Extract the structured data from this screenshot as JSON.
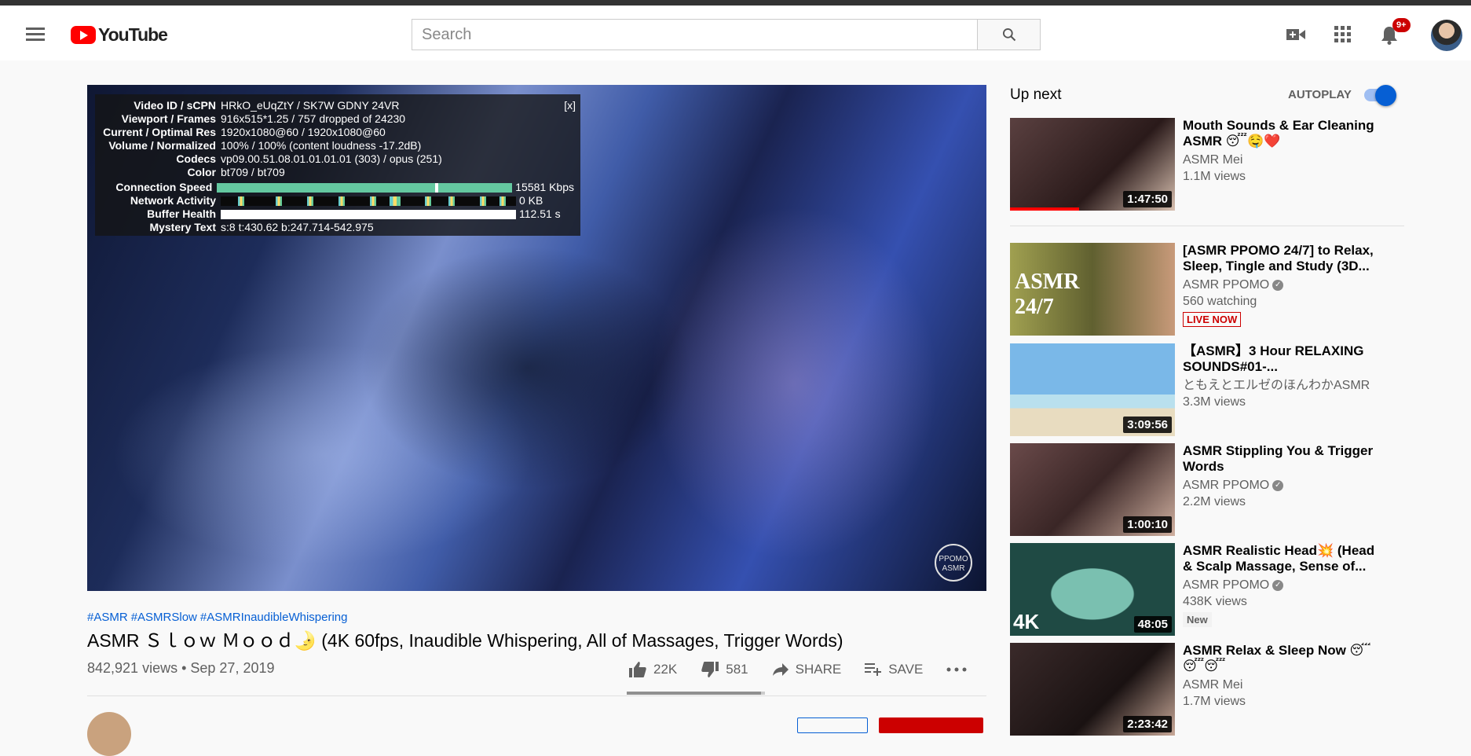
{
  "header": {
    "logo_text": "YouTube",
    "search_placeholder": "Search",
    "notification_count": "9+"
  },
  "player": {
    "stats_close": "[x]",
    "stats": [
      {
        "label": "Video ID / sCPN",
        "value": "HRkO_eUqZtY / SK7W GDNY 24VR"
      },
      {
        "label": "Viewport / Frames",
        "value": "916x515*1.25 / 757 dropped of 24230"
      },
      {
        "label": "Current / Optimal Res",
        "value": "1920x1080@60 / 1920x1080@60"
      },
      {
        "label": "Volume / Normalized",
        "value": "100% / 100% (content loudness -17.2dB)"
      },
      {
        "label": "Codecs",
        "value": "vp09.00.51.08.01.01.01.01 (303) / opus (251)"
      },
      {
        "label": "Color",
        "value": "bt709 / bt709"
      }
    ],
    "graphs": [
      {
        "label": "Connection Speed",
        "value": "15581 Kbps"
      },
      {
        "label": "Network Activity",
        "value": "0 KB"
      },
      {
        "label": "Buffer Health",
        "value": "112.51 s"
      }
    ],
    "mystery": {
      "label": "Mystery Text",
      "value": "s:8 t:430.62 b:247.714-542.975"
    },
    "watermark": "PPOMO ASMR"
  },
  "video": {
    "hashtags": [
      "#ASMR",
      "#ASMRSlow",
      "#ASMRInaudibleWhispering"
    ],
    "title": "ASMR Ｓｌｏｗ Ｍｏｏｄ🌛 (4K 60fps, Inaudible Whispering, All of Massages, Trigger Words)",
    "views": "842,921 views",
    "date": "Sep 27, 2019",
    "likes": "22K",
    "dislikes": "581",
    "share_label": "SHARE",
    "save_label": "SAVE",
    "like_ratio": 0.974
  },
  "sidebar": {
    "up_next": "Up next",
    "autoplay": "AUTOPLAY",
    "autoplay_on": true,
    "items": [
      {
        "title": "Mouth Sounds & Ear Cleaning ASMR 😴🤤❤️",
        "channel": "ASMR Mei",
        "meta": "1.1M views",
        "duration": "1:47:50",
        "thumb": "#3a2a2a"
      },
      {
        "title": "[ASMR PPOMO 24/7] to Relax, Sleep, Tingle and Study (3D...",
        "channel": "ASMR PPOMO",
        "meta": "560 watching",
        "badge": "LIVE NOW",
        "thumb_text": "ASMR 24/7",
        "thumb": "#8a8a3a"
      },
      {
        "title": "【ASMR】3 Hour RELAXING SOUNDS#01-...",
        "channel": "ともえとエルゼのほんわかASMR",
        "meta": "3.3M views",
        "duration": "3:09:56",
        "thumb": "#8fc4e0"
      },
      {
        "title": "ASMR Stippling You & Trigger Words",
        "channel": "ASMR PPOMO",
        "meta": "2.2M views",
        "duration": "1:00:10",
        "thumb": "#5a3a3a"
      },
      {
        "title": "ASMR Realistic Head💥 (Head & Scalp Massage, Sense of...",
        "channel": "ASMR PPOMO",
        "meta": "438K views",
        "duration": "48:05",
        "badge": "New",
        "thumb_text": "4K",
        "thumb": "#1f5a50"
      },
      {
        "title": "ASMR Relax & Sleep Now 😴😴😴",
        "channel": "ASMR Mei",
        "meta": "1.7M views",
        "duration": "2:23:42",
        "thumb": "#2a2020"
      }
    ]
  }
}
